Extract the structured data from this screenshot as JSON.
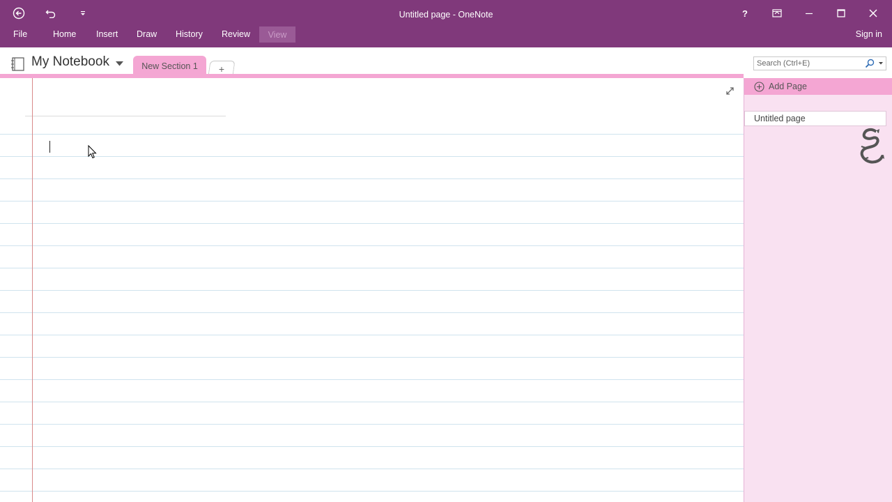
{
  "window": {
    "title": "Untitled page - OneNote"
  },
  "titlebar": {
    "back_icon": "back-circle-icon",
    "undo_icon": "undo-icon",
    "customize_icon": "customize-qat-icon",
    "help_label": "?"
  },
  "menu": {
    "items": [
      "File",
      "Home",
      "Insert",
      "Draw",
      "History",
      "Review",
      "View"
    ],
    "active": "View",
    "signin_label": "Sign in"
  },
  "notebook": {
    "name": "My Notebook",
    "section_tab": "New Section 1",
    "add_tab_label": "+"
  },
  "search": {
    "placeholder": "Search (Ctrl+E)"
  },
  "pages": {
    "add_page_label": "Add Page",
    "items": [
      "Untitled page"
    ]
  },
  "colors": {
    "ribbon": "#80397b",
    "section": "#f4a6d3",
    "pane": "#f9e1f1"
  }
}
